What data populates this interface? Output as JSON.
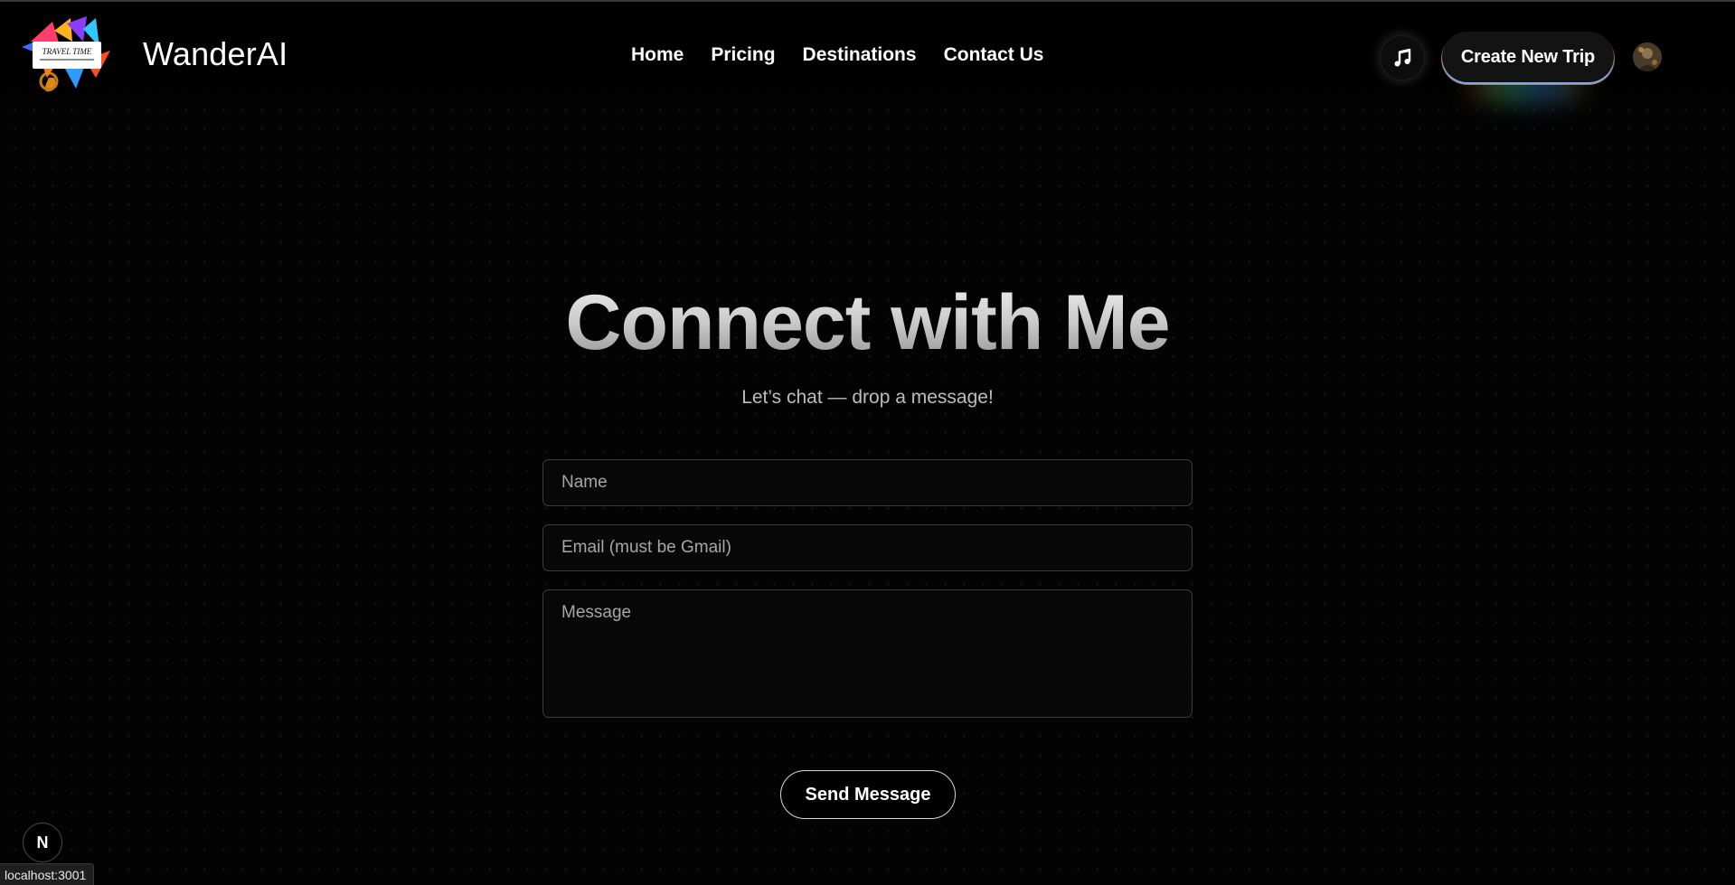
{
  "header": {
    "brand": "WanderAI",
    "logo_icon": "travel-time-collage-logo",
    "logo_text": "TRAVEL TIME",
    "nav": [
      {
        "label": "Home"
      },
      {
        "label": "Pricing"
      },
      {
        "label": "Destinations"
      },
      {
        "label": "Contact Us"
      }
    ],
    "music_icon": "music-note-icon",
    "create_button": "Create New Trip",
    "avatar_icon": "user-avatar"
  },
  "hero": {
    "title": "Connect with Me",
    "subtitle": "Let’s chat — drop a message!"
  },
  "form": {
    "name_placeholder": "Name",
    "email_placeholder": "Email (must be Gmail)",
    "message_placeholder": "Message",
    "send_label": "Send Message"
  },
  "footer": {
    "dev_badge_letter": "N",
    "status_url": "localhost:3001"
  },
  "colors": {
    "background": "#030303",
    "text": "#ffffff",
    "muted_text": "#bdbdbd",
    "field_border": "#3b3b3b"
  }
}
